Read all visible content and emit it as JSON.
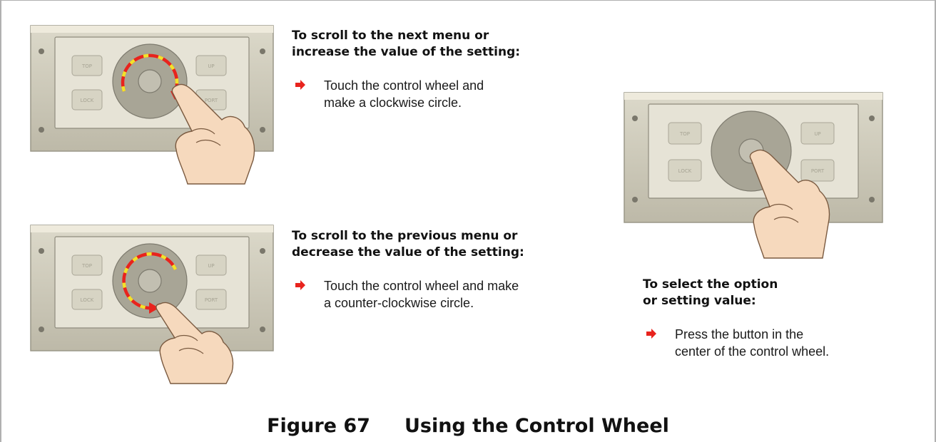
{
  "sections": [
    {
      "heading": "To scroll to the next menu or\nincrease the value of the setting:",
      "bullet": "Touch the control wheel and\nmake a clockwise circle."
    },
    {
      "heading": "To scroll  to the previous menu or\ndecrease the value of the setting:",
      "bullet": "Touch the control wheel and make\na counter-clockwise circle."
    },
    {
      "heading": "To select the option\nor setting value:",
      "bullet": "Press the button in the\ncenter of the control wheel."
    }
  ],
  "panel_buttons": {
    "top": "TOP",
    "lock": "LOCK",
    "up": "UP",
    "port": "PORT"
  },
  "caption": {
    "number": "Figure 67",
    "title": "Using the Control Wheel"
  },
  "colors": {
    "arrow_red": "#e8231d",
    "arrow_yellow": "#f2e22a",
    "panel_outer": "#cdc9b9",
    "panel_inner": "#e3e0d2",
    "wheel": "#a8a596",
    "skin": "#f6d9bd",
    "bullet": "#e8231d"
  },
  "icons": [
    "bullet-arrow-icon",
    "control-panel-illustration",
    "hand-illustration"
  ]
}
